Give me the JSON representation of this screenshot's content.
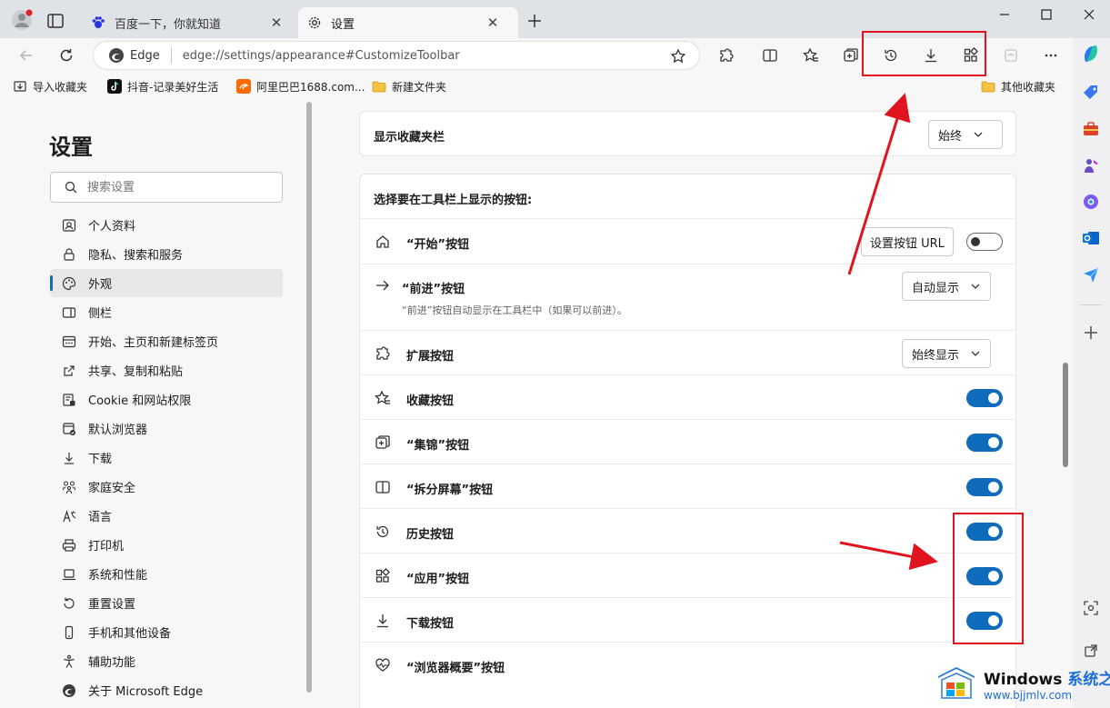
{
  "tabs": [
    {
      "title": "百度一下，你就知道",
      "icon": "baidu-paw-icon"
    },
    {
      "title": "设置",
      "icon": "gear-icon"
    }
  ],
  "toolbar": {
    "address_site": "Edge",
    "address_url": "edge://settings/appearance#CustomizeToolbar"
  },
  "favorites": [
    {
      "label": "导入收藏夹",
      "icon": "import-favorites-icon"
    },
    {
      "label": "抖音-记录美好生活",
      "icon": "douyin-icon"
    },
    {
      "label": "阿里巴巴1688.com...",
      "icon": "alibaba-icon"
    },
    {
      "label": "新建文件夹",
      "icon": "folder-icon"
    },
    {
      "label": "其他收藏夹",
      "icon": "folder-icon"
    }
  ],
  "settings": {
    "title": "设置",
    "search_placeholder": "搜索设置",
    "nav": [
      {
        "label": "个人资料",
        "icon": "profile-icon",
        "active": false
      },
      {
        "label": "隐私、搜索和服务",
        "icon": "lock-icon",
        "active": false
      },
      {
        "label": "外观",
        "icon": "palette-icon",
        "active": true
      },
      {
        "label": "侧栏",
        "icon": "sidebar-icon",
        "active": false
      },
      {
        "label": "开始、主页和新建标签页",
        "icon": "home-tab-icon",
        "active": false
      },
      {
        "label": "共享、复制和粘贴",
        "icon": "share-icon",
        "active": false
      },
      {
        "label": "Cookie 和网站权限",
        "icon": "cookie-permissions-icon",
        "active": false
      },
      {
        "label": "默认浏览器",
        "icon": "browser-icon",
        "active": false
      },
      {
        "label": "下载",
        "icon": "download-icon",
        "active": false
      },
      {
        "label": "家庭安全",
        "icon": "family-icon",
        "active": false
      },
      {
        "label": "语言",
        "icon": "language-icon",
        "active": false
      },
      {
        "label": "打印机",
        "icon": "printer-icon",
        "active": false
      },
      {
        "label": "系统和性能",
        "icon": "laptop-icon",
        "active": false
      },
      {
        "label": "重置设置",
        "icon": "reset-icon",
        "active": false
      },
      {
        "label": "手机和其他设备",
        "icon": "phone-icon",
        "active": false
      },
      {
        "label": "辅助功能",
        "icon": "accessibility-icon",
        "active": false
      },
      {
        "label": "关于 Microsoft Edge",
        "icon": "edge-logo-icon",
        "active": false
      }
    ]
  },
  "content": {
    "favbar_setting": {
      "label": "显示收藏夹栏",
      "value": "始终"
    },
    "section_title": "选择要在工具栏上显示的按钮:",
    "rows": [
      {
        "label": "“开始”按钮",
        "icon": "home-icon",
        "control": "button+toggle",
        "button_label": "设置按钮 URL",
        "on": false
      },
      {
        "label": "“前进”按钮",
        "icon": "forward-arrow-icon",
        "control": "dropdown",
        "value": "自动显示",
        "desc": "“前进”按钮自动显示在工具栏中（如果可以前进）。"
      },
      {
        "label": "扩展按钮",
        "icon": "extensions-icon",
        "control": "dropdown",
        "value": "始终显示"
      },
      {
        "label": "收藏按钮",
        "icon": "favorites-star-icon",
        "control": "toggle",
        "on": true
      },
      {
        "label": "“集锦”按钮",
        "icon": "collections-icon",
        "control": "toggle",
        "on": true
      },
      {
        "label": "“拆分屏幕”按钮",
        "icon": "split-screen-icon",
        "control": "toggle",
        "on": true
      },
      {
        "label": "历史按钮",
        "icon": "history-icon",
        "control": "toggle",
        "on": true
      },
      {
        "label": "“应用”按钮",
        "icon": "apps-icon",
        "control": "toggle",
        "on": true
      },
      {
        "label": "下载按钮",
        "icon": "download-icon",
        "control": "toggle",
        "on": true
      },
      {
        "label": "“浏览器概要”按钮",
        "icon": "heartbeat-icon",
        "control": "none"
      }
    ]
  },
  "watermark": {
    "brand": "Windows",
    "brand_cn": "系统之家",
    "url": "www.bjjmlv.com"
  },
  "colors": {
    "accent": "#0f6cbd",
    "annotation_red": "#e0141e"
  }
}
